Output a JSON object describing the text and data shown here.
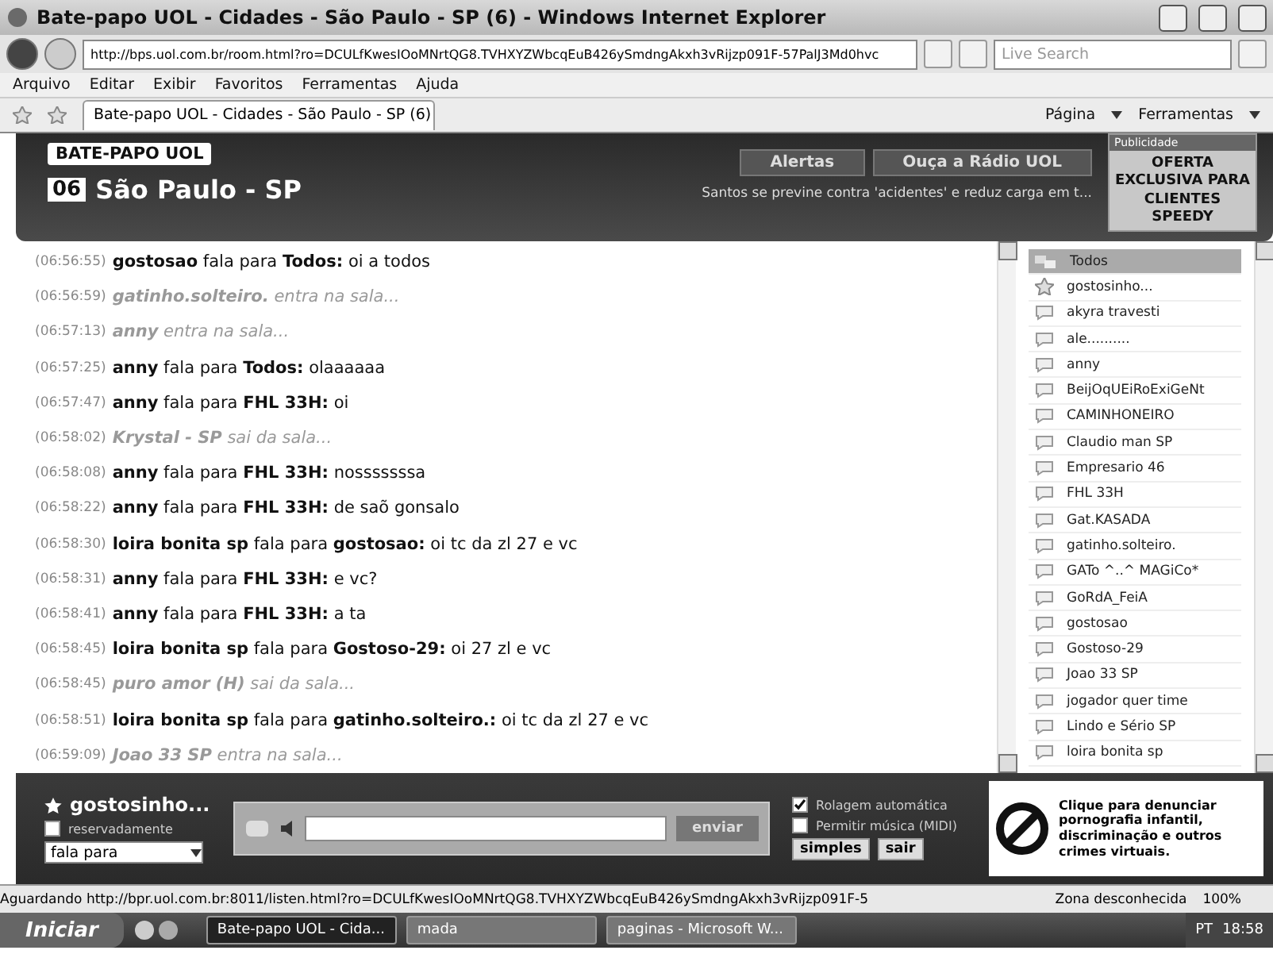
{
  "browser": {
    "title": "Bate-papo UOL - Cidades - São Paulo - SP (6) - Windows Internet Explorer",
    "url": "http://bps.uol.com.br/room.html?ro=DCULfKwesIOoMNrtQG8.TVHXYZWbcqEuB426ySmdngAkxh3vRijzp091F-57PalJ3Md0hvc",
    "search_placeholder": "Live Search",
    "menu": [
      "Arquivo",
      "Editar",
      "Exibir",
      "Favoritos",
      "Ferramentas",
      "Ajuda"
    ],
    "tab": "Bate-papo UOL - Cidades - São Paulo - SP (6)",
    "tools": [
      "Página",
      "Ferramentas"
    ]
  },
  "header": {
    "logo": "BATE-PAPO UOL",
    "room_number": "06",
    "room": "São Paulo - SP",
    "buttons": [
      "Alertas",
      "Ouça a Rádio UOL"
    ],
    "news": "Santos se previne contra 'acidentes' e reduz carga em t...",
    "ad_label": "Publicidade",
    "ad_text": "OFERTA EXCLUSIVA PARA CLIENTES SPEEDY"
  },
  "messages": [
    {
      "kind": "say",
      "time": "(06:56:55)",
      "user": "gostosao",
      "verb": "fala para",
      "target": "Todos:",
      "text": "oi a todos"
    },
    {
      "kind": "event",
      "time": "(06:56:59)",
      "user": "gatinho.solteiro.",
      "text": "entra na sala..."
    },
    {
      "kind": "event",
      "time": "(06:57:13)",
      "user": "anny",
      "text": "entra na sala..."
    },
    {
      "kind": "say",
      "time": "(06:57:25)",
      "user": "anny",
      "verb": "fala para",
      "target": "Todos:",
      "text": "olaaaaaa"
    },
    {
      "kind": "say",
      "time": "(06:57:47)",
      "user": "anny",
      "verb": "fala para",
      "target": "FHL 33H:",
      "text": "oi"
    },
    {
      "kind": "event",
      "time": "(06:58:02)",
      "user": "Krystal - SP",
      "text": "sai da sala..."
    },
    {
      "kind": "say",
      "time": "(06:58:08)",
      "user": "anny",
      "verb": "fala para",
      "target": "FHL 33H:",
      "text": "nosssssssa"
    },
    {
      "kind": "say",
      "time": "(06:58:22)",
      "user": "anny",
      "verb": "fala para",
      "target": "FHL 33H:",
      "text": "de saõ gonsalo"
    },
    {
      "kind": "say",
      "time": "(06:58:30)",
      "user": "loira bonita sp",
      "verb": "fala para",
      "target": "gostosao:",
      "text": "oi tc da zl 27 e vc"
    },
    {
      "kind": "say",
      "time": "(06:58:31)",
      "user": "anny",
      "verb": "fala para",
      "target": "FHL 33H:",
      "text": "e vc?"
    },
    {
      "kind": "say",
      "time": "(06:58:41)",
      "user": "anny",
      "verb": "fala para",
      "target": "FHL 33H:",
      "text": "a ta"
    },
    {
      "kind": "say",
      "time": "(06:58:45)",
      "user": "loira bonita sp",
      "verb": "fala para",
      "target": "Gostoso-29:",
      "text": "oi 27 zl e vc"
    },
    {
      "kind": "event",
      "time": "(06:58:45)",
      "user": "puro amor (H)",
      "text": "sai da sala..."
    },
    {
      "kind": "say",
      "time": "(06:58:51)",
      "user": "loira bonita sp",
      "verb": "fala para",
      "target": "gatinho.solteiro.:",
      "text": "oi tc da zl 27 e vc"
    },
    {
      "kind": "event",
      "time": "(06:59:09)",
      "user": "Joao 33 SP",
      "text": "entra na sala..."
    }
  ],
  "users": [
    {
      "kind": "all",
      "name": "Todos",
      "selected": true
    },
    {
      "kind": "self",
      "name": "gostosinho...",
      "selected": false
    },
    {
      "kind": "user",
      "name": "akyra travesti",
      "selected": false
    },
    {
      "kind": "user",
      "name": "ale..........",
      "selected": false
    },
    {
      "kind": "user",
      "name": "anny",
      "selected": false
    },
    {
      "kind": "user",
      "name": "BeijOqUEiRoExiGeNt",
      "selected": false
    },
    {
      "kind": "user",
      "name": "CAMINHONEIRO",
      "selected": false
    },
    {
      "kind": "user",
      "name": "Claudio man SP",
      "selected": false
    },
    {
      "kind": "user",
      "name": "Empresario 46",
      "selected": false
    },
    {
      "kind": "user",
      "name": "FHL 33H",
      "selected": false
    },
    {
      "kind": "user",
      "name": "Gat.KASADA",
      "selected": false
    },
    {
      "kind": "user",
      "name": "gatinho.solteiro.",
      "selected": false
    },
    {
      "kind": "user",
      "name": "GATo ^..^ MAGiCo*",
      "selected": false
    },
    {
      "kind": "user",
      "name": "GoRdA_FeiA",
      "selected": false
    },
    {
      "kind": "user",
      "name": "gostosao",
      "selected": false
    },
    {
      "kind": "user",
      "name": "Gostoso-29",
      "selected": false
    },
    {
      "kind": "user",
      "name": "Joao 33 SP",
      "selected": false
    },
    {
      "kind": "user",
      "name": "jogador quer time",
      "selected": false
    },
    {
      "kind": "user",
      "name": "Lindo e Sério SP",
      "selected": false
    },
    {
      "kind": "user",
      "name": "loira bonita sp",
      "selected": false
    }
  ],
  "composer": {
    "nickname": "gostosinho...",
    "reserved": {
      "label": "reservadamente",
      "checked": false
    },
    "recipient": "fala para",
    "send": "enviar",
    "options": [
      {
        "label": "Rolagem automática",
        "checked": true
      },
      {
        "label": "Permitir música (MIDI)",
        "checked": false
      }
    ],
    "buttons": [
      "simples",
      "sair"
    ],
    "report": "Clique para denunciar pornografia infantil, discriminação e outros crimes virtuais."
  },
  "status_bar": {
    "text": "Aguardando http://bpr.uol.com.br:8011/listen.html?ro=DCULfKwesIOoMNrtQG8.TVHXYZWbcqEuB426ySmdngAkxh3vRijzp091F-5",
    "zone": "Zona desconhecida",
    "zoom": "100%"
  },
  "taskbar": {
    "start": "Iniciar",
    "tasks": [
      {
        "label": "Bate-papo UOL - Cida...",
        "selected": true
      },
      {
        "label": "mada",
        "selected": false
      },
      {
        "label": "paginas - Microsoft W...",
        "selected": false
      }
    ],
    "lang": "PT",
    "clock": "18:58"
  }
}
